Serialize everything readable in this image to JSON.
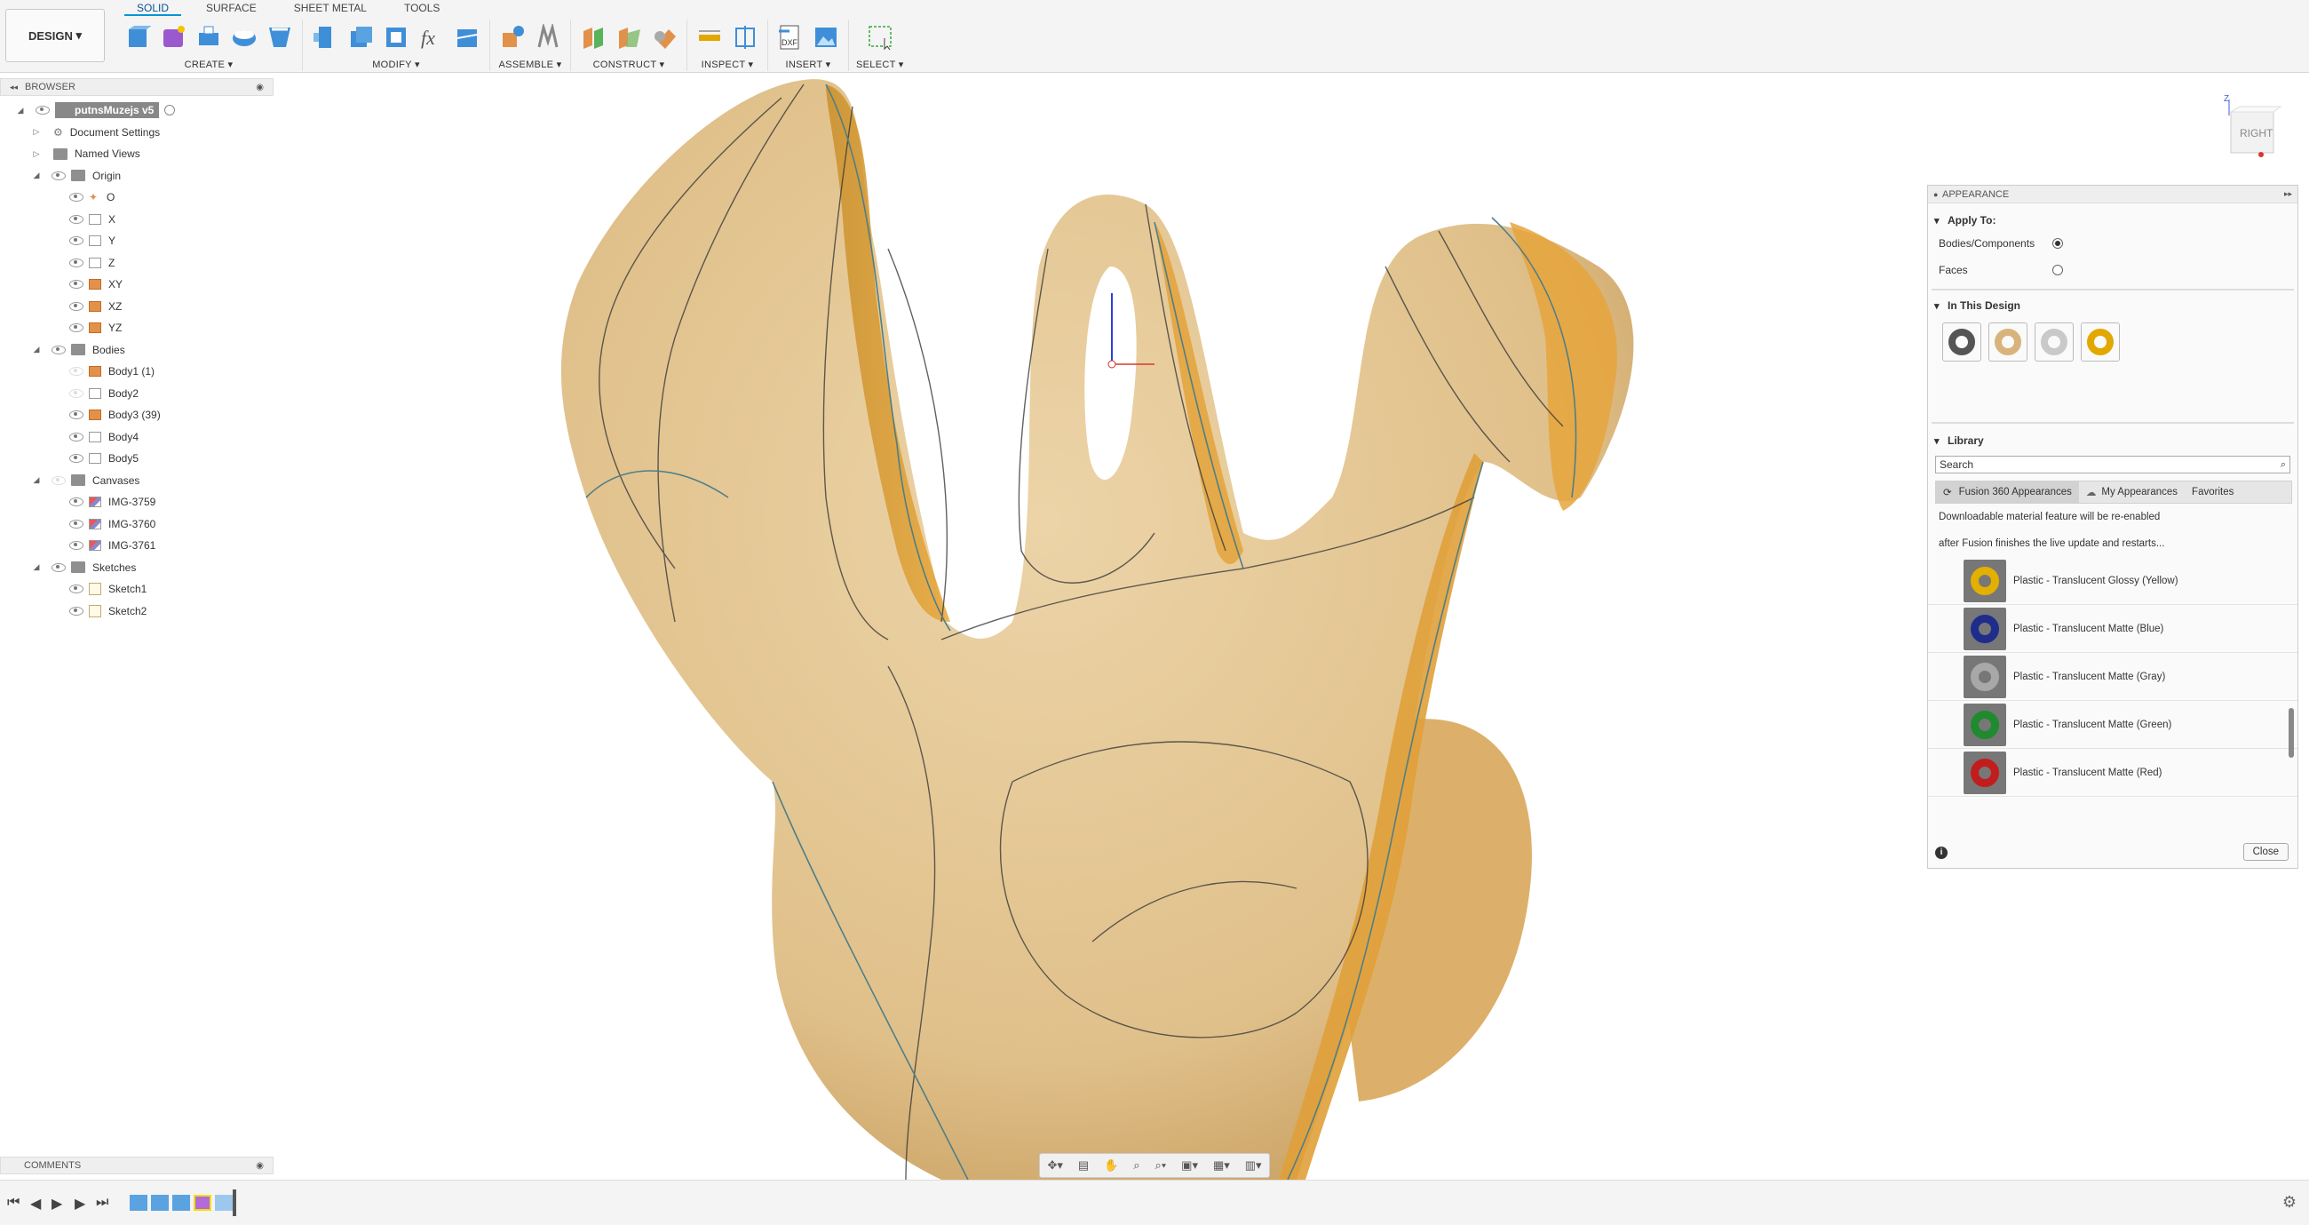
{
  "toolbar": {
    "workspace": "DESIGN",
    "tabs": [
      "SOLID",
      "SURFACE",
      "SHEET METAL",
      "TOOLS"
    ],
    "groups": [
      "CREATE",
      "MODIFY",
      "ASSEMBLE",
      "CONSTRUCT",
      "INSPECT",
      "INSERT",
      "SELECT"
    ]
  },
  "browser": {
    "title": "BROWSER",
    "root": "putnsMuzejs v5",
    "items": [
      {
        "label": "Document Settings"
      },
      {
        "label": "Named Views"
      },
      {
        "label": "Origin"
      },
      {
        "label": "O"
      },
      {
        "label": "X"
      },
      {
        "label": "Y"
      },
      {
        "label": "Z"
      },
      {
        "label": "XY"
      },
      {
        "label": "XZ"
      },
      {
        "label": "YZ"
      },
      {
        "label": "Bodies"
      },
      {
        "label": "Body1 (1)"
      },
      {
        "label": "Body2"
      },
      {
        "label": "Body3 (39)"
      },
      {
        "label": "Body4"
      },
      {
        "label": "Body5"
      },
      {
        "label": "Canvases"
      },
      {
        "label": "IMG-3759"
      },
      {
        "label": "IMG-3760"
      },
      {
        "label": "IMG-3761"
      },
      {
        "label": "Sketches"
      },
      {
        "label": "Sketch1"
      },
      {
        "label": "Sketch2"
      }
    ]
  },
  "comments": {
    "title": "COMMENTS"
  },
  "viewcube": {
    "face": "RIGHT",
    "axis": "Z"
  },
  "appearance": {
    "title": "APPEARANCE",
    "apply_to": "Apply To:",
    "opt_bodies": "Bodies/Components",
    "opt_faces": "Faces",
    "in_design": "In This Design",
    "design_swatches": [
      "#555555",
      "#d8b47c",
      "#c9c9c9",
      "#e2a800"
    ],
    "library": "Library",
    "search_placeholder": "Search",
    "tabs": [
      "Fusion 360 Appearances",
      "My Appearances",
      "Favorites"
    ],
    "note1": "Downloadable material feature will be re-enabled",
    "note2": "after Fusion finishes the live update and restarts...",
    "materials": [
      {
        "name": "Plastic - Translucent Glossy (Yellow)",
        "color": "#e3b000"
      },
      {
        "name": "Plastic - Translucent Matte (Blue)",
        "color": "#1e2d8c"
      },
      {
        "name": "Plastic - Translucent Matte (Gray)",
        "color": "#a8a8a8"
      },
      {
        "name": "Plastic - Translucent Matte (Green)",
        "color": "#1f8a2e"
      },
      {
        "name": "Plastic - Translucent Matte (Red)",
        "color": "#c21d1d"
      }
    ],
    "close": "Close"
  }
}
